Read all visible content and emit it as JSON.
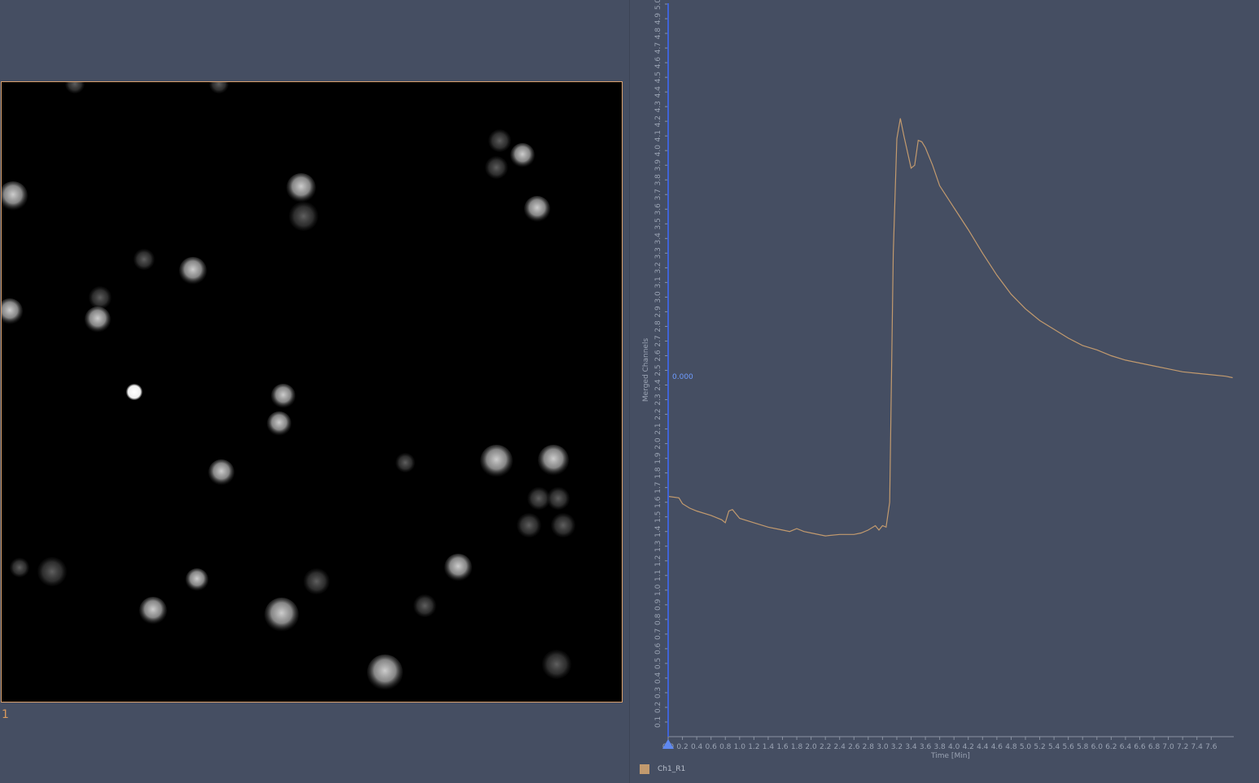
{
  "image_viewer": {
    "index_label": "1",
    "frame_color": "#d9a06d"
  },
  "chart_data": {
    "type": "line",
    "xlabel": "Time [Min]",
    "ylabel": "Merged Channels",
    "xlim": [
      0,
      7.9
    ],
    "ylim": [
      0,
      5.0
    ],
    "x_ticks": [
      0.0,
      0.2,
      0.4,
      0.6,
      0.8,
      1.0,
      1.2,
      1.4,
      1.6,
      1.8,
      2.0,
      2.2,
      2.4,
      2.6,
      2.8,
      3.0,
      3.2,
      3.4,
      3.6,
      3.8,
      4.0,
      4.2,
      4.4,
      4.6,
      4.8,
      5.0,
      5.2,
      5.4,
      5.6,
      5.8,
      6.0,
      6.2,
      6.4,
      6.6,
      6.8,
      7.0,
      7.2,
      7.4,
      7.6
    ],
    "x_tick_labels": [
      "0.0",
      "0.2",
      "0.4",
      "0.6",
      "0.8",
      "1.0",
      "1.2",
      "1.4",
      "1.6",
      "1.8",
      "2.0",
      "2.2",
      "2.4",
      "2.6",
      "2.8",
      "3.0",
      "3.2",
      "3.4",
      "3.6",
      "3.8",
      "4.0",
      "4.2",
      "4.4",
      "4.6",
      "4.8",
      "5.0",
      "5.2",
      "5.4",
      "5.6",
      "5.8",
      "6.0",
      "6.2",
      "6.4",
      "6.6",
      "6.8",
      "7.0",
      "7.2",
      "7.4",
      "7.6"
    ],
    "y_ticks": [
      0.1,
      0.2,
      0.3,
      0.4,
      0.5,
      0.6,
      0.7,
      0.8,
      0.9,
      1.0,
      1.1,
      1.2,
      1.3,
      1.4,
      1.5,
      1.6,
      1.7,
      1.8,
      1.9,
      2.0,
      2.1,
      2.2,
      2.3,
      2.4,
      2.5,
      2.6,
      2.7,
      2.8,
      2.9,
      3.0,
      3.1,
      3.2,
      3.3,
      3.4,
      3.5,
      3.6,
      3.7,
      3.8,
      3.9,
      4.0,
      4.1,
      4.2,
      4.3,
      4.4,
      4.5,
      4.6,
      4.7,
      4.8,
      4.9,
      5.0
    ],
    "y_tick_labels": [
      "0.1",
      "0.2",
      "0.3",
      "0.4",
      "0.5",
      "0.6",
      "0.7",
      "0.8",
      "0.9",
      "1.0",
      "1.1",
      "1.2",
      "1.3",
      "1.4",
      "1.5",
      "1.6",
      "1.7",
      "1.8",
      "1.9",
      "2.0",
      "2.1",
      "2.2",
      "2.3",
      "2.4",
      "2.5",
      "2.6",
      "2.7",
      "2.8",
      "2.9",
      "3.0",
      "3.1",
      "3.2",
      "3.3",
      "3.4",
      "3.5",
      "3.6",
      "3.7",
      "3.8",
      "3.9",
      "4.0",
      "4.1",
      "4.2",
      "4.3",
      "4.4",
      "4.5",
      "4.6",
      "4.7",
      "4.8",
      "4.9",
      "5.0"
    ],
    "cursor": {
      "x": 0.0,
      "value_label": "0.000"
    },
    "series": [
      {
        "name": "Ch1_R1",
        "color": "#c29a6e",
        "x": [
          0.0,
          0.15,
          0.2,
          0.3,
          0.4,
          0.6,
          0.75,
          0.8,
          0.85,
          0.9,
          0.95,
          1.0,
          1.2,
          1.4,
          1.6,
          1.7,
          1.8,
          1.9,
          2.0,
          2.2,
          2.4,
          2.6,
          2.7,
          2.8,
          2.9,
          2.95,
          3.0,
          3.05,
          3.1,
          3.15,
          3.2,
          3.25,
          3.3,
          3.4,
          3.45,
          3.5,
          3.55,
          3.6,
          3.7,
          3.8,
          4.0,
          4.2,
          4.4,
          4.6,
          4.8,
          5.0,
          5.2,
          5.4,
          5.6,
          5.8,
          6.0,
          6.2,
          6.4,
          6.6,
          6.8,
          7.0,
          7.2,
          7.4,
          7.6,
          7.8,
          7.9
        ],
        "y": [
          1.64,
          1.63,
          1.59,
          1.56,
          1.54,
          1.51,
          1.48,
          1.46,
          1.54,
          1.55,
          1.52,
          1.49,
          1.46,
          1.43,
          1.41,
          1.4,
          1.42,
          1.4,
          1.39,
          1.37,
          1.38,
          1.38,
          1.39,
          1.41,
          1.44,
          1.41,
          1.44,
          1.43,
          1.6,
          3.3,
          4.08,
          4.22,
          4.1,
          3.88,
          3.9,
          4.07,
          4.06,
          4.02,
          3.9,
          3.76,
          3.61,
          3.46,
          3.3,
          3.15,
          3.02,
          2.92,
          2.84,
          2.78,
          2.72,
          2.67,
          2.64,
          2.6,
          2.57,
          2.55,
          2.53,
          2.51,
          2.49,
          2.48,
          2.47,
          2.46,
          2.45
        ]
      }
    ]
  }
}
